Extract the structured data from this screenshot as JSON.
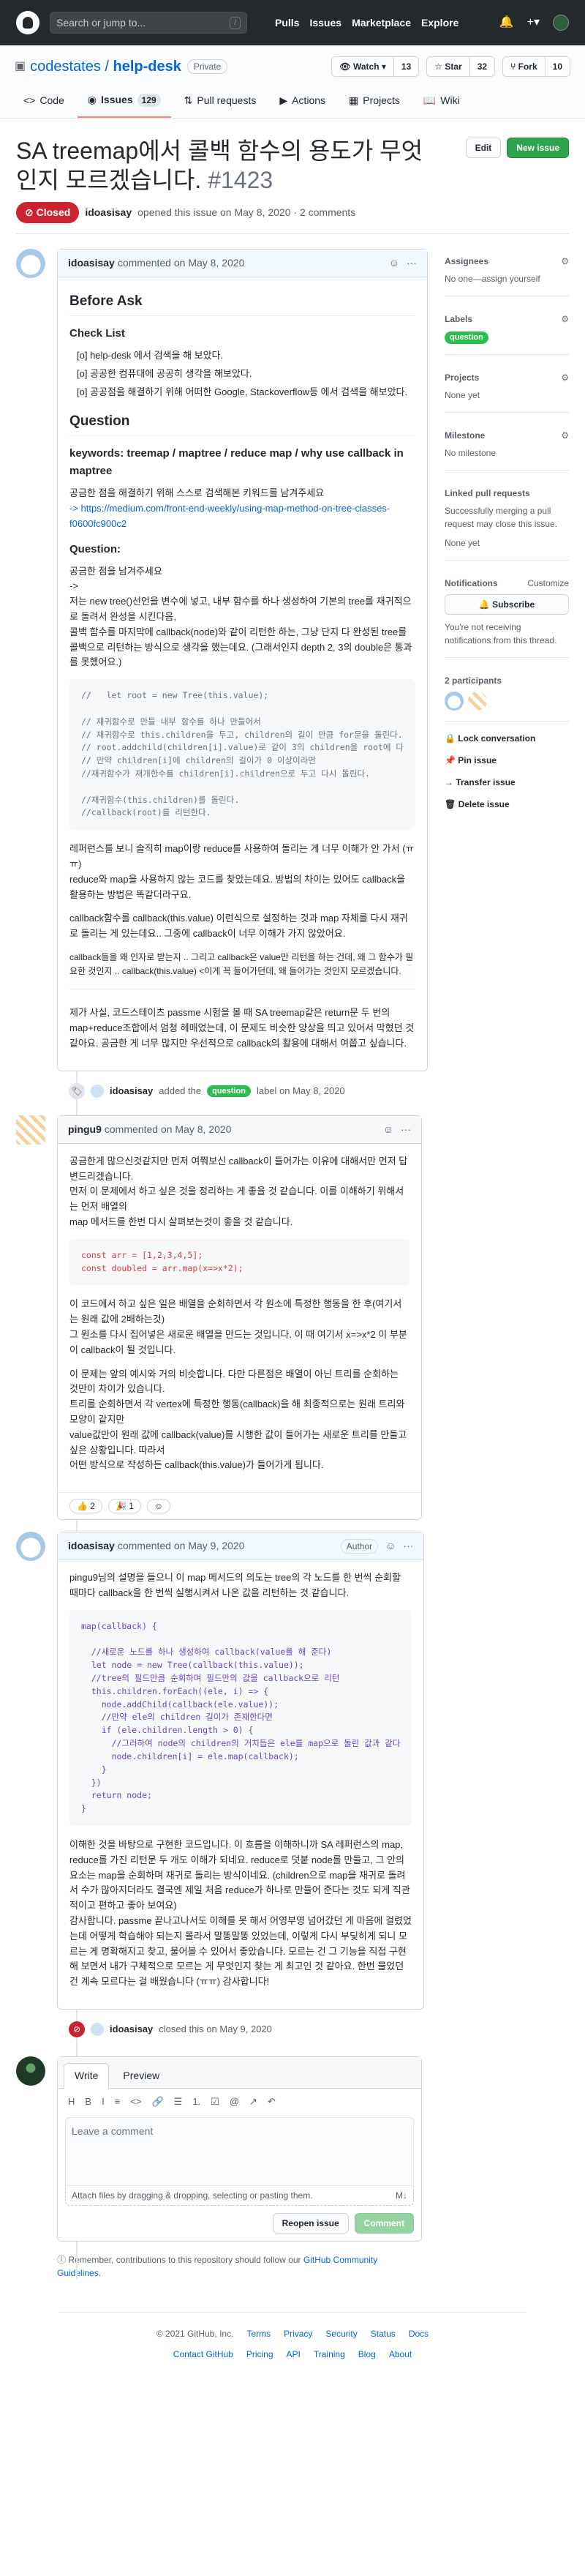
{
  "header": {
    "search_placeholder": "Search or jump to...",
    "slash_key": "/",
    "nav": [
      "Pulls",
      "Issues",
      "Marketplace",
      "Explore"
    ]
  },
  "repo": {
    "owner": "codestates",
    "name": "help-desk",
    "visibility": "Private",
    "watch_label": "Watch",
    "watch_count": "13",
    "star_label": "Star",
    "star_count": "32",
    "fork_label": "Fork",
    "fork_count": "10",
    "tabs": [
      {
        "label": "Code"
      },
      {
        "label": "Issues",
        "count": "129"
      },
      {
        "label": "Pull requests"
      },
      {
        "label": "Actions"
      },
      {
        "label": "Projects"
      },
      {
        "label": "Wiki"
      }
    ]
  },
  "issue": {
    "title": "SA treemap에서 콜백 함수의 용도가 무엇인지 모르겠습니다.",
    "number": "#1423",
    "edit_label": "Edit",
    "new_label": "New issue",
    "state": "Closed",
    "author": "idoasisay",
    "opened_text": "opened this issue on May 8, 2020 · 2 comments"
  },
  "comment1": {
    "author": "idoasisay",
    "date": "commented on May 8, 2020",
    "before_ask": "Before Ask",
    "checklist_title": "Check List",
    "checklist": [
      "[o] help-desk 에서 검색을 해 보았다.",
      "[o] 공공한 컴퓨대에 공공히 생각을 해보았다.",
      "[o] 공공점을 해결하기 위해 어떠한 Google, Stackoverflow등 에서 검색을 해보았다."
    ],
    "question_heading": "Question",
    "keywords": "keywords: treemap / maptree / reduce map / why use callback in maptree",
    "p1": "공금한 점을 해결하기 위해 스스로 검색해본 키워드를 남겨주세요",
    "link": "-> https://medium.com/front-end-weekly/using-map-method-on-tree-classes-f0600fc900c2",
    "question_label": "Question:",
    "p2": "공금한 점을 남겨주세요\n->\n저는 new tree()선언을 변수에 넣고, 내부 함수를 하나 생성하여 기본의 tree를 재귀적으로 돌려서 완성을 시킨다음,\n콜백 함수를 마지막에 callback(node)와 같이 리턴한 하는, 그냥 단지 다 완성된 tree를 콜백으로 리턴하는 방식으로 생각을 했는데요. (그래서인지 depth 2, 3의 double은 통과를 못했어요.)",
    "code1": "//   let root = new Tree(this.value);\n\n// 재귀함수로 만들 내부 함수를 하나 만들어서\n// 재귀함수로 this.children을 두고, children의 길이 만큼 for문을 돌린다.\n// root.addchild(children[i].value)로 같이 3의 children을 root에 다\n// 만약 children[i]에 children의 길이가 0 이상이라면\n//재귀함수가 재개한수를 children[i].children으로 두고 다시 돌린다.\n\n//재귀함수(this.children)를 돌린다.\n//callback(root)를 리턴한다.",
    "p3": "레퍼런스를 보니 솔직히 map이랑 reduce를 사용하여 돌리는 게 너무 이해가 안 가서 (ㅠㅠ)\nreduce와 map을 사용하지 않는 코드를 찾았는데요. 방법의 차이는 있어도 callback을 활용하는 방법은 똑같더라구요.",
    "p4": "callback함수를 callback(this.value) 이런식으로 설정하는 것과 map 자체를 다시 재귀로 돌리는 게 있는데요.. 그중에 callback이 너무 이해가 가지 않았어요.",
    "p5": "callback들을 왜 인자로 받는지 .. 그리고 callback은 value만 리턴을 하는 건데, 왜 그 함수가 필요한 것인지 .. callback(this.value) <이게 꼭 들어가던데, 왜 들어가는 것인지 모르겠습니다.",
    "p6": "제가 사실, 코드스테이츠 passme 시험을 볼 때 SA treemap같은 return문 두 번의 map+reduce조합에서 엄청 헤매었는데, 이 문제도 비슷한 양상을 띄고 있어서 막혔던 것 같아요. 공금한 게 너무 많지만 우선적으로 callback의 활용에 대해서 여쭙고 싶습니다."
  },
  "event1": {
    "actor": "idoasisay",
    "text": "added the",
    "label": "question",
    "suffix": "label on May 8, 2020"
  },
  "comment2": {
    "author": "pingu9",
    "date": "commented on May 8, 2020",
    "p1": "공금한게 많으신것같지만 먼저 여쭤보신 callback이 들어가는 이유에 대해서만 먼저 답변드리겠습니다.\n먼저 이 문제에서 하고 싶은 것을 정리하는 게 좋을 것 같습니다. 이를 이해하기 위해서는 먼저 배열의\nmap 메서드를 한번 다시 살펴보는것이 좋을 것 같습니다.",
    "code": "const arr = [1,2,3,4,5];\nconst doubled = arr.map(x=>x*2);",
    "p2": "이 코드에서 하고 싶은 일은 배열을 순회하면서 각 원소에 특정한 행동을 한 후(여기서는 원래 값에 2배하는것)\n그 원소를 다시 집어넣은 새로운 배열을 만드는 것입니다. 이 때 여기서 x=>x*2 이 부분이 callback이 될 것입니다.",
    "p3": "이 문제는 앞의 예시와 거의 비슷합니다. 다만 다른점은 배열이 아닌 트리를 순회하는 것만이 차이가 있습니다.\n트리를 순회하면서 각 vertex에 특정한 행동(callback)을 해 최종적으로는 원래 트리와 모양이 같지만\nvalue값만이 원래 값에 callback(value)를 시행한 값이 들어가는 새로운 트리를 만들고 싶은 상황입니다. 따라서\n어떤 방식으로 작성하든 callback(this.value)가 들어가게 됩니다.",
    "reacts": [
      "👍 2",
      "🎉 1"
    ]
  },
  "comment3": {
    "author": "idoasisay",
    "date": "commented on May 9, 2020",
    "tag": "Author",
    "p1": "pingu9님의 설명을 들으니 이 map 메서드의 의도는 tree의 각 노드를 한 번씩 순회할 때마다 callback을 한 번씩 실행시켜서 나온 값을 리턴하는 것 같습니다.",
    "code": "map(callback) {\n\n  //새로운 노드를 하나 생성하여 callback(value를 해 준다)\n  let node = new Tree(callback(this.value));\n  //tree의 필드만큼 순회하며 필드만의 값을 callback으로 리턴\n  this.children.forEach((ele, i) => {\n    node.addChild(callback(ele.value));\n    //만약 ele의 children 길이가 존재한다면\n    if (ele.children.length > 0) {\n      //그러하여 node의 children의 거치듭은 ele를 map으로 돌린 값과 같다\n      node.children[i] = ele.map(callback);\n    }\n  })\n  return node;\n}",
    "p2": "이해한 것을 바탕으로 구현한 코드입니다. 이 흐름을 이해하니까 SA 레퍼런스의 map, reduce를 가진 리턴문 두 개도 이해가 되네요. reduce로 덧붙 node를 만들고, 그 안의 요소는 map을 순회하며 재귀로 돌리는 방식이네요. (children으로 map을 재귀로 돌려서 수가 많아지더라도 결국엔 제일 처음 reduce가 하나로 만들어 준다는 것도 되게 직관적이고 편하고 좋아 보여요)\n감사합니다. passme 끝나고나서도 이해를 못 해서 어영부영 넘어갔던 게 마음에 걸렸었는데 어떻게 학습해야 되는지 몰라서 말똥말똥 있었는데, 이렇게 다시 부딪히게 되니 모르는 게 명확해지고 찾고, 물어볼 수 있어서 좋았습니다. 모르는 건 그 기능을 직접 구현해 보면서 내가 구체적으로 모르는 게 무엇인지 찾는 게 최고인 것 같아요. 한번 물었던 건 계속 모르다는 걸 배웠습니다 (ㅠㅠ) 감사합니다!"
  },
  "event2": {
    "actor": "idoasisay",
    "text": "closed this on May 9, 2020"
  },
  "compose": {
    "tab_write": "Write",
    "tab_preview": "Preview",
    "toolbar": [
      "H",
      "B",
      "I",
      "≡",
      "<>",
      "🔗",
      "☰",
      "1.",
      "☑",
      "@",
      "↗",
      "↶"
    ],
    "placeholder": "Leave a comment",
    "attach": "Attach files by dragging & dropping, selecting or pasting them.",
    "reopen_label": "Reopen issue",
    "comment_label": "Comment"
  },
  "remember": {
    "text": "Remember, contributions to this repository should follow our",
    "link": "GitHub Community Guidelines."
  },
  "sidebar": {
    "assignees": {
      "title": "Assignees",
      "value": "No one—assign yourself"
    },
    "labels": {
      "title": "Labels",
      "value": "question"
    },
    "projects": {
      "title": "Projects",
      "value": "None yet"
    },
    "milestone": {
      "title": "Milestone",
      "value": "No milestone"
    },
    "linked": {
      "title": "Linked pull requests",
      "desc": "Successfully merging a pull request may close this issue.",
      "value": "None yet"
    },
    "notifications": {
      "title": "Notifications",
      "customize": "Customize",
      "button": "Subscribe",
      "desc": "You're not receiving notifications from this thread."
    },
    "participants": {
      "title": "2 participants"
    },
    "actions": [
      "Lock conversation",
      "Pin issue",
      "Transfer issue",
      "Delete issue"
    ]
  },
  "footer": {
    "copyright": "© 2021 GitHub, Inc.",
    "row1": [
      "Terms",
      "Privacy",
      "Security",
      "Status",
      "Docs"
    ],
    "row2": [
      "Contact GitHub",
      "Pricing",
      "API",
      "Training",
      "Blog",
      "About"
    ]
  }
}
